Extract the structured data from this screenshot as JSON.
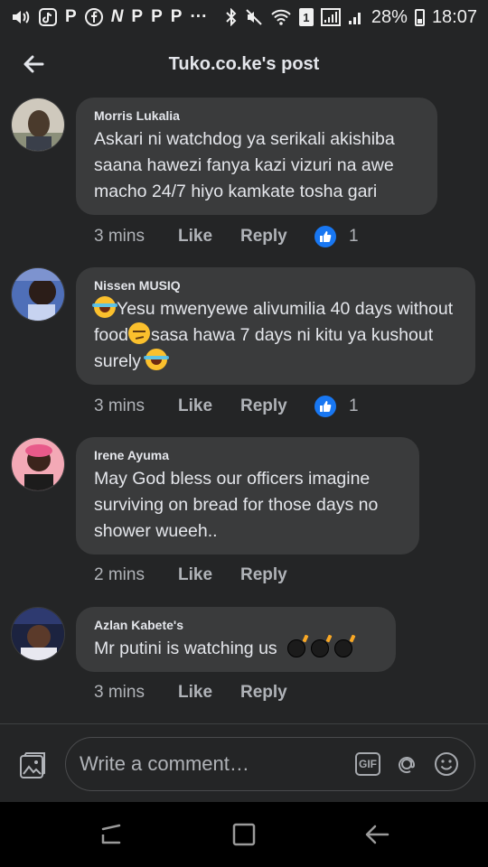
{
  "status_bar": {
    "left_letters": [
      "P",
      "N",
      "P",
      "P",
      "P"
    ],
    "more": "···",
    "sim_badge": "1",
    "battery": "28%",
    "time": "18:07"
  },
  "header": {
    "title": "Tuko.co.ke's post"
  },
  "comments": [
    {
      "author": "Morris Lukalia",
      "text": "Askari ni watchdog ya serikali akishiba saana hawezi fanya kazi vizuri na awe macho 24/7 hiyo kamkate tosha gari",
      "time": "3 mins",
      "like": "Like",
      "reply": "Reply",
      "reactions": "1"
    },
    {
      "author": "Nissen MUSIQ",
      "text_parts": [
        "Yesu mwenyewe alivumilia 40 days without food",
        "sasa hawa 7 days ni kitu ya kushout surely "
      ],
      "time": "3 mins",
      "like": "Like",
      "reply": "Reply",
      "reactions": "1"
    },
    {
      "author": "Irene Ayuma",
      "text": "May God bless our officers imagine surviving on bread for those days no shower wueeh..",
      "time": "2 mins",
      "like": "Like",
      "reply": "Reply"
    },
    {
      "author": "Azlan Kabete's",
      "text": "Mr putini is watching us ",
      "time": "3 mins",
      "like": "Like",
      "reply": "Reply"
    }
  ],
  "composer": {
    "placeholder": "Write a comment…",
    "gif_label": "GIF"
  },
  "colors": {
    "background": "#242526",
    "bubble": "#3a3b3c",
    "text_primary": "#e4e6eb",
    "text_secondary": "#b0b3b8",
    "like_blue": "#1877f2"
  }
}
